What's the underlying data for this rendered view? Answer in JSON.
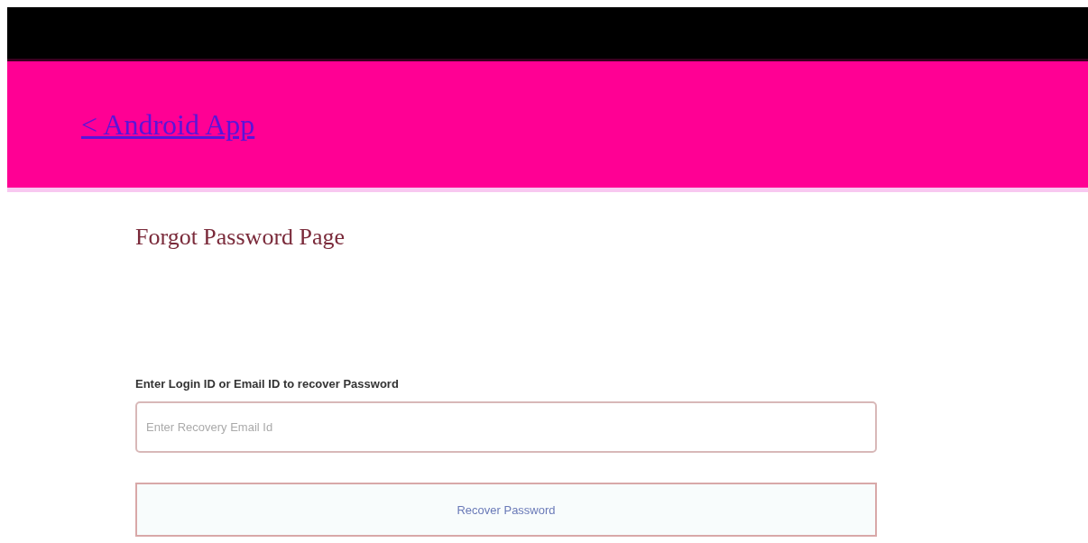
{
  "header": {
    "back_link": "< Android App"
  },
  "page_title": "Forgot Password Page",
  "form": {
    "label": "Enter Login ID or Email ID to recover Password",
    "placeholder": "Enter Recovery Email Id",
    "button": "Recover Password"
  }
}
